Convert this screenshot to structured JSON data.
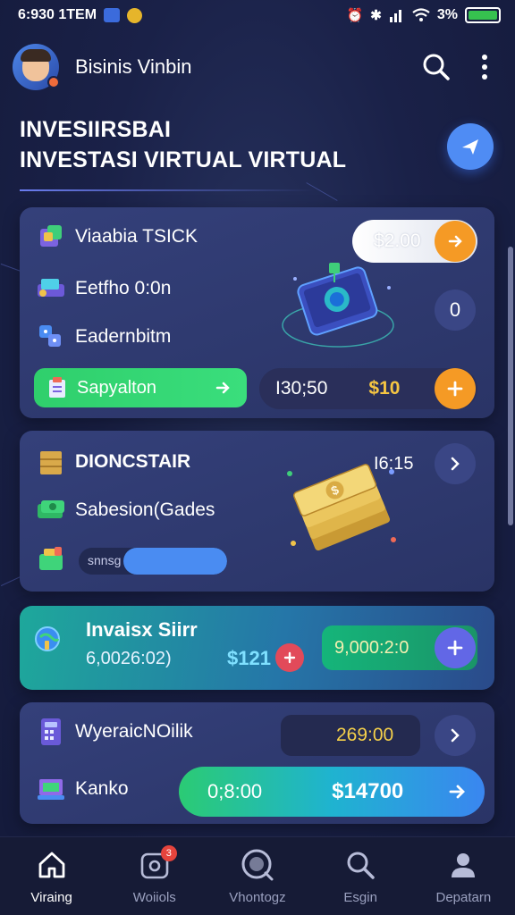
{
  "status_bar": {
    "time": "6:930 1TEM",
    "battery_percent": "3%",
    "icons": [
      "app-square-icon",
      "notification-dot-icon",
      "alarm-icon",
      "bluetooth-icon",
      "signal-icon",
      "wifi-icon",
      "battery-icon"
    ]
  },
  "header": {
    "title": "Bisinis Vinbin",
    "icons": [
      "avatar",
      "search-icon",
      "more-vertical-icon"
    ]
  },
  "page": {
    "title_line1": "INVESIIRSBAI",
    "title_line2": "INVESTASI VIRTUAL VIRTUAL"
  },
  "card1": {
    "row1_label": "Viaabia TSICK",
    "row2_label": "Eetfho 0:0n",
    "row3_label": "Eadernbitm",
    "pill_value": "$2.00",
    "count_value": "0",
    "green_button_label": "Sapyalton",
    "amount_left": "I30;50",
    "amount_right": "$10",
    "colors": {
      "orange": "#f59a25",
      "green": "#2fcf6c"
    }
  },
  "card2": {
    "row1_label": "DIONCSTAIR",
    "row2_label": "Sabesion(Gades",
    "bar_label": "snnsg",
    "time_value": "I6:15",
    "bar_fill_fraction": 0.7
  },
  "card3": {
    "title": "Invaisx Siirr",
    "subtitle": "6,0026:02)",
    "amount": "$121",
    "field_value": "9,000:2:0"
  },
  "card4": {
    "row1_label": "WyeraicNOilik",
    "row2_label": "Kanko",
    "dark_value": "269:00",
    "cta_left": "0;8:00",
    "cta_right": "$14700"
  },
  "bottom_nav": {
    "items": [
      {
        "label": "Viraing",
        "icon": "home-icon"
      },
      {
        "label": "Woiiols",
        "icon": "photo-icon"
      },
      {
        "label": "Vhontogz",
        "icon": "search-circle-icon"
      },
      {
        "label": "Esgin",
        "icon": "search-icon"
      },
      {
        "label": "Depatarn",
        "icon": "person-icon"
      }
    ],
    "badge": "3"
  }
}
